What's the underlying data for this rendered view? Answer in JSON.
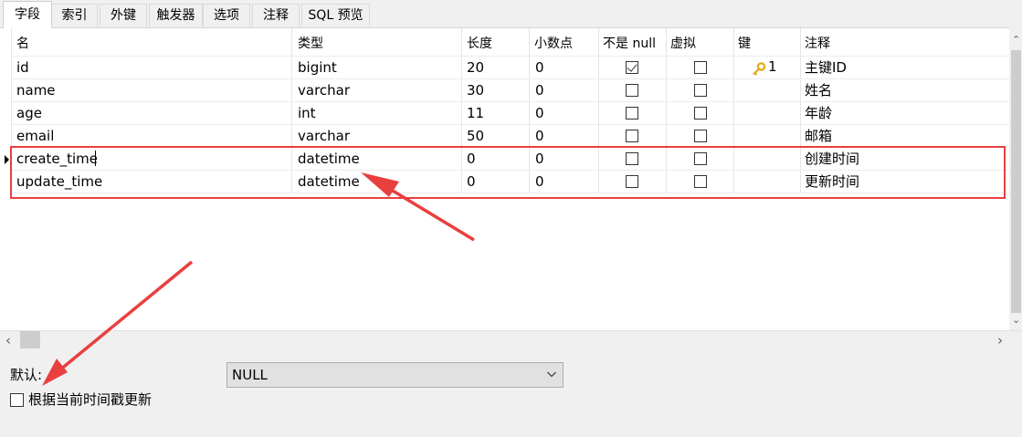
{
  "tabs": [
    "字段",
    "索引",
    "外键",
    "触发器",
    "选项",
    "注释",
    "SQL 预览"
  ],
  "active_tab": "字段",
  "columns": [
    "名",
    "类型",
    "长度",
    "小数点",
    "不是 null",
    "虚拟",
    "键",
    "注释"
  ],
  "rows": [
    {
      "name": "id",
      "type": "bigint",
      "length": "20",
      "decimals": "0",
      "not_null": true,
      "virtual": false,
      "key": "1",
      "comment": "主键ID"
    },
    {
      "name": "name",
      "type": "varchar",
      "length": "30",
      "decimals": "0",
      "not_null": false,
      "virtual": false,
      "key": "",
      "comment": "姓名"
    },
    {
      "name": "age",
      "type": "int",
      "length": "11",
      "decimals": "0",
      "not_null": false,
      "virtual": false,
      "key": "",
      "comment": "年龄"
    },
    {
      "name": "email",
      "type": "varchar",
      "length": "50",
      "decimals": "0",
      "not_null": false,
      "virtual": false,
      "key": "",
      "comment": "邮箱"
    },
    {
      "name": "create_time",
      "type": "datetime",
      "length": "0",
      "decimals": "0",
      "not_null": false,
      "virtual": false,
      "key": "",
      "comment": "创建时间"
    },
    {
      "name": "update_time",
      "type": "datetime",
      "length": "0",
      "decimals": "0",
      "not_null": false,
      "virtual": false,
      "key": "",
      "comment": "更新时间"
    }
  ],
  "selected_row": "create_time",
  "key_icon": "key-icon",
  "bottom": {
    "default_label": "默认:",
    "default_value": "NULL",
    "update_checkbox_label": "根据当前时间戳更新",
    "update_checkbox_checked": false
  },
  "colors": {
    "annotation": "#e8403f",
    "key_icon": "#e6a817"
  }
}
